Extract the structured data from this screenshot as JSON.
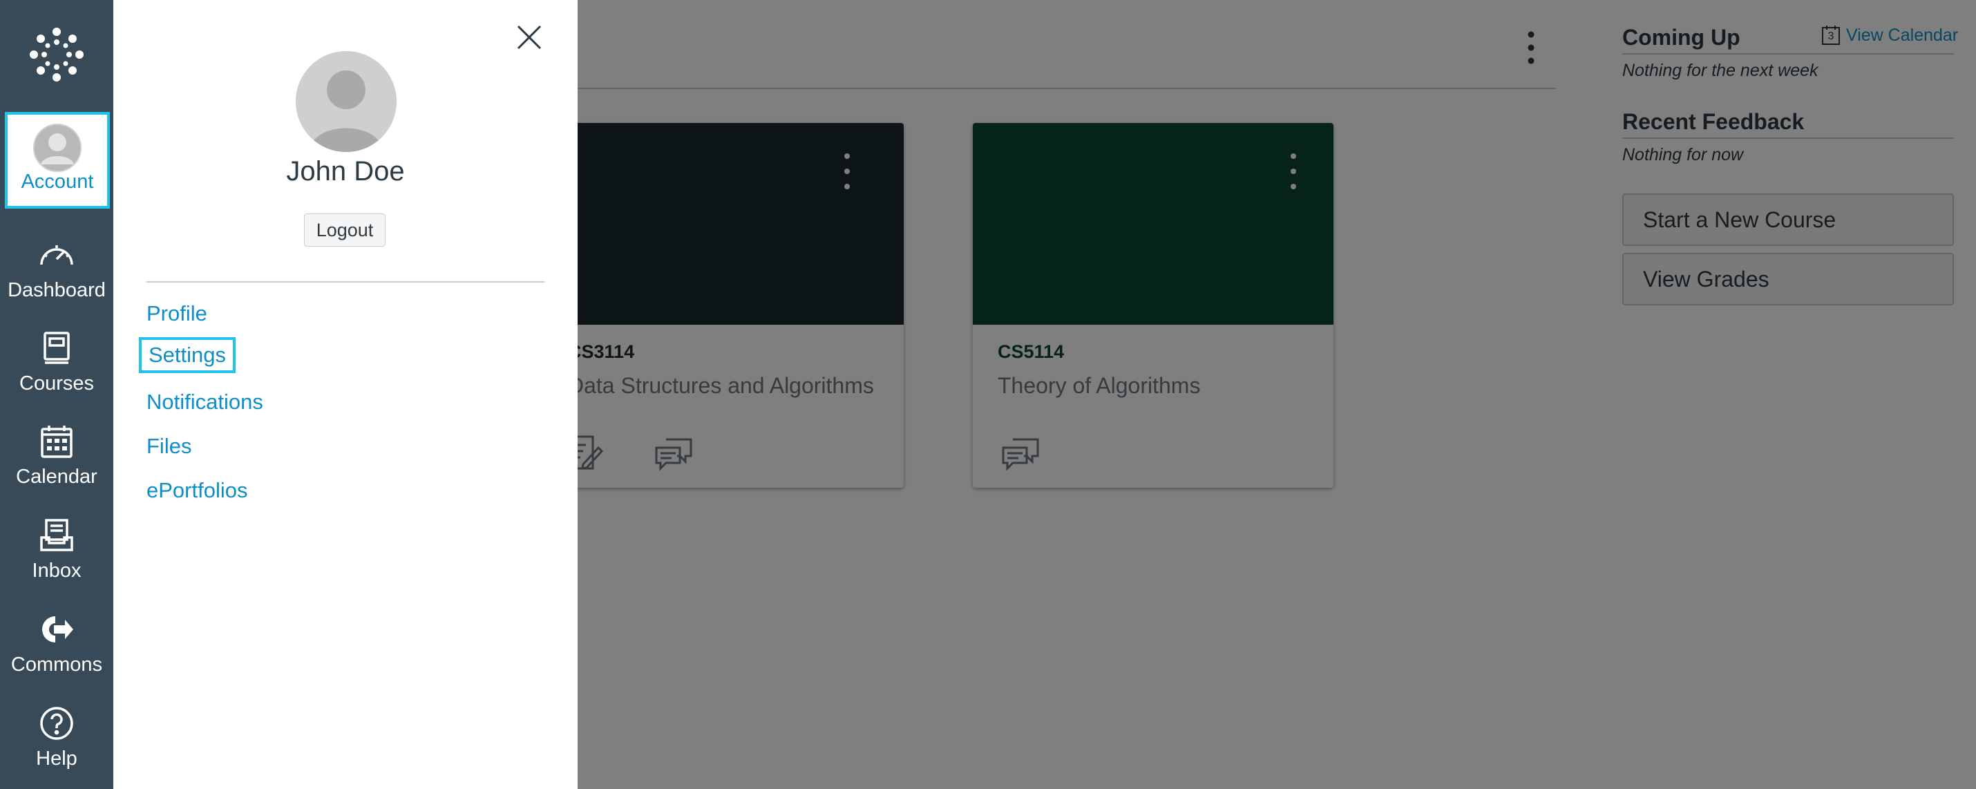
{
  "nav": {
    "items": [
      {
        "label": "Account",
        "icon": "avatar-icon"
      },
      {
        "label": "Dashboard",
        "icon": "dashboard-icon"
      },
      {
        "label": "Courses",
        "icon": "courses-icon"
      },
      {
        "label": "Calendar",
        "icon": "calendar-icon"
      },
      {
        "label": "Inbox",
        "icon": "inbox-icon"
      },
      {
        "label": "Commons",
        "icon": "commons-icon"
      },
      {
        "label": "Help",
        "icon": "help-icon"
      }
    ],
    "colors": {
      "background": "#384a57",
      "active": "#0d8ec9",
      "focus": "#1fc3ec"
    }
  },
  "tray": {
    "user_name": "John Doe",
    "logout_label": "Logout",
    "links": [
      "Profile",
      "Settings",
      "Notifications",
      "Files",
      "ePortfolios"
    ],
    "selected_link": "Settings"
  },
  "dashboard": {
    "cards": [
      {
        "code": "CS3114",
        "name": "Data Structures and Algorithms",
        "color": "#1b2a30"
      },
      {
        "code": "CS5114",
        "name": "Theory of Algorithms",
        "color": "#0b4537"
      }
    ]
  },
  "sidebar": {
    "coming_up_title": "Coming Up",
    "view_calendar_label": "View Calendar",
    "calendar_day": "3",
    "coming_up_note": "Nothing for the next week",
    "recent_feedback_title": "Recent Feedback",
    "recent_feedback_note": "Nothing for now",
    "start_course_label": "Start a New Course",
    "view_grades_label": "View Grades"
  }
}
